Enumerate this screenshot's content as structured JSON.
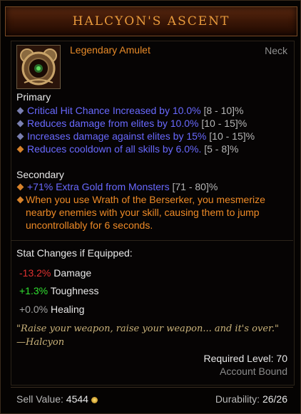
{
  "item": {
    "name": "HALCYON'S ASCENT",
    "type": "Legendary Amulet",
    "slot": "Neck"
  },
  "primary": {
    "heading": "Primary",
    "affixes": [
      {
        "text": "Critical Hit Chance Increased by 10.0%",
        "range": "[8 - 10]%"
      },
      {
        "text": "Reduces damage from elites by 10.0%",
        "range": "[10 - 15]%"
      },
      {
        "text": "Increases damage against elites by 15%",
        "range": "[10 - 15]%"
      },
      {
        "text": "Reduces cooldown of all skills by 6.0%.",
        "range": "[5 - 8]%"
      }
    ]
  },
  "secondary": {
    "heading": "Secondary",
    "affixes": [
      {
        "text": "+71% Extra Gold from Monsters",
        "range": "[71 - 80]%"
      }
    ],
    "legendary_power": "When you use Wrath of the Berserker, you mesmerize nearby enemies with your skill, causing them to jump uncontrollably for 6 seconds."
  },
  "stat_changes": {
    "heading": "Stat Changes if Equipped:",
    "rows": [
      {
        "value": "-13.2%",
        "label": "Damage",
        "color": "#e03030"
      },
      {
        "value": "+1.3%",
        "label": "Toughness",
        "color": "#30e030"
      },
      {
        "value": "+0.0%",
        "label": "Healing",
        "color": "#a0a0a0"
      }
    ]
  },
  "flavor": {
    "quote": "\"Raise your weapon, raise your weapon... and it's over.\"",
    "author": "—Halcyon"
  },
  "requirements": {
    "level": "Required Level: 70",
    "bound": "Account Bound"
  },
  "footer": {
    "sell_label": "Sell Value:",
    "sell_value": "4544",
    "durability_label": "Durability:",
    "durability_value": "26/26"
  },
  "icons": {
    "amulet": "amulet-icon",
    "gold": "gold-coin-icon",
    "bullet": "diamond-bullet-icon"
  }
}
